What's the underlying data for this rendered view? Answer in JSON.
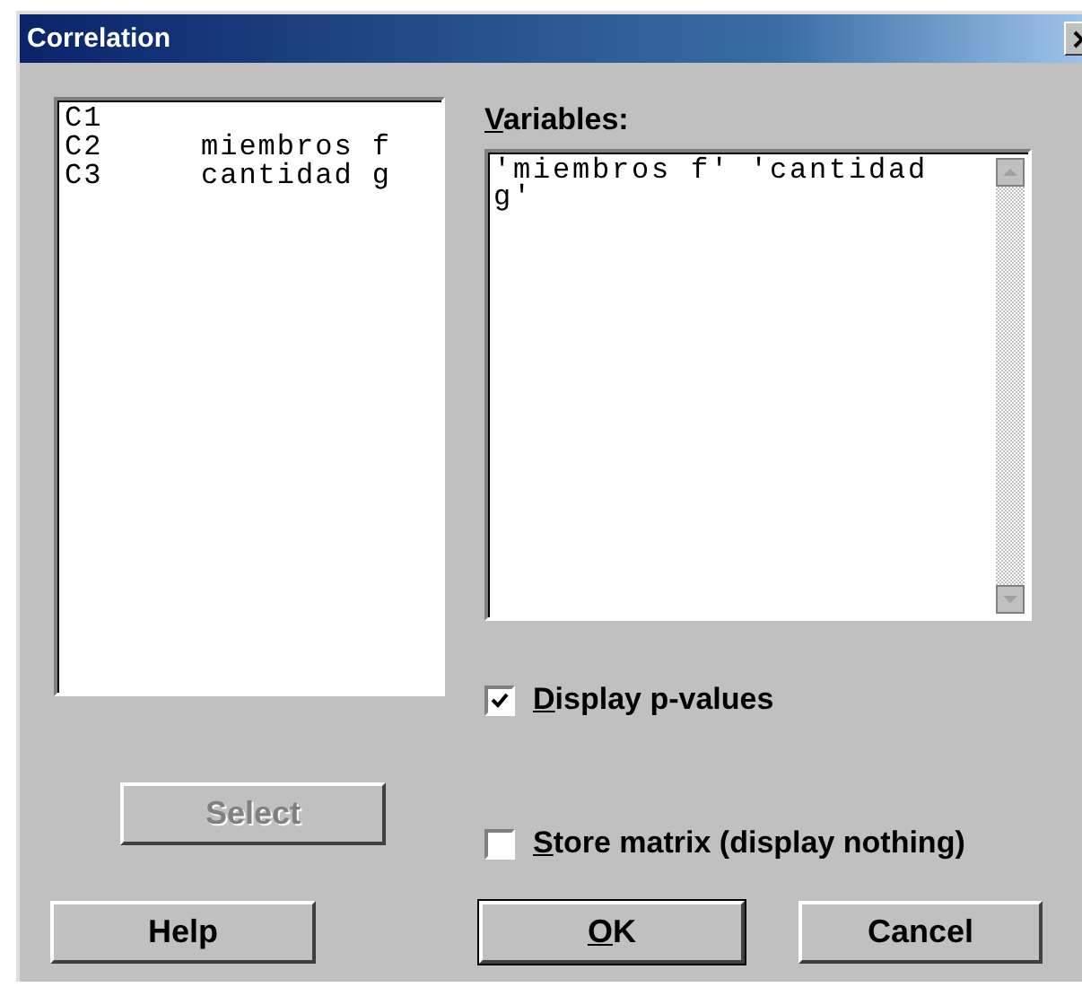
{
  "window": {
    "title": "Correlation"
  },
  "columns_list": [
    {
      "column": "C1"
    },
    {
      "column": "C2",
      "name": "miembros f"
    },
    {
      "column": "C3",
      "name": "cantidad g"
    }
  ],
  "variables": {
    "access_key": "V",
    "label_rest": "ariables:",
    "value": "'miembros f' 'cantidad g'"
  },
  "options": [
    {
      "access_key": "D",
      "label_rest": "isplay p-values",
      "checked": true
    },
    {
      "access_key": "S",
      "label_rest": "tore matrix (display nothing)",
      "checked": false
    }
  ],
  "select_button": {
    "label": "Select",
    "disabled": true
  },
  "buttons": [
    {
      "label": "Help"
    },
    {
      "access_key": "O",
      "label_rest": "K",
      "default": true
    },
    {
      "label": "Cancel"
    }
  ]
}
